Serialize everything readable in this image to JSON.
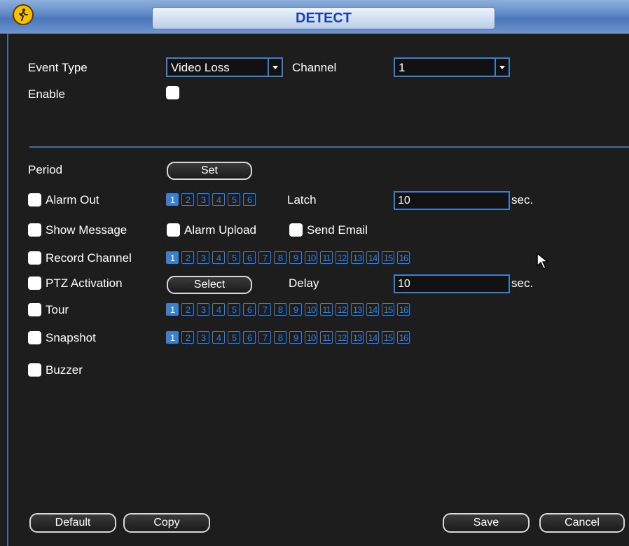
{
  "window": {
    "title": "DETECT",
    "icon": "running-man-icon"
  },
  "event_type": {
    "label": "Event Type",
    "value": "Video Loss"
  },
  "channel": {
    "label": "Channel",
    "value": "1"
  },
  "enable": {
    "label": "Enable",
    "checked": false
  },
  "period": {
    "label": "Period",
    "button": "Set"
  },
  "alarm_out": {
    "label": "Alarm Out",
    "checked": false,
    "outputs": [
      "1",
      "2",
      "3",
      "4",
      "5",
      "6"
    ],
    "selected": [
      "1"
    ]
  },
  "latch": {
    "label": "Latch",
    "value": "10",
    "unit": "sec."
  },
  "show_message": {
    "label": "Show Message",
    "checked": false
  },
  "alarm_upload": {
    "label": "Alarm Upload",
    "checked": false
  },
  "send_email": {
    "label": "Send Email",
    "checked": false
  },
  "record_channel": {
    "label": "Record Channel",
    "checked": false,
    "channels": [
      "1",
      "2",
      "3",
      "4",
      "5",
      "6",
      "7",
      "8",
      "9",
      "10",
      "11",
      "12",
      "13",
      "14",
      "15",
      "16"
    ],
    "selected": [
      "1"
    ]
  },
  "ptz_activation": {
    "label": "PTZ Activation",
    "checked": false,
    "button": "Select"
  },
  "delay": {
    "label": "Delay",
    "value": "10",
    "unit": "sec."
  },
  "tour": {
    "label": "Tour",
    "checked": false,
    "channels": [
      "1",
      "2",
      "3",
      "4",
      "5",
      "6",
      "7",
      "8",
      "9",
      "10",
      "11",
      "12",
      "13",
      "14",
      "15",
      "16"
    ],
    "selected": [
      "1"
    ]
  },
  "snapshot": {
    "label": "Snapshot",
    "checked": false,
    "channels": [
      "1",
      "2",
      "3",
      "4",
      "5",
      "6",
      "7",
      "8",
      "9",
      "10",
      "11",
      "12",
      "13",
      "14",
      "15",
      "16"
    ],
    "selected": [
      "1"
    ]
  },
  "buzzer": {
    "label": "Buzzer",
    "checked": false
  },
  "footer": {
    "default": "Default",
    "copy": "Copy",
    "save": "Save",
    "cancel": "Cancel"
  },
  "colors": {
    "title_bg": "#5b86c4",
    "accent": "#3a7fd0",
    "panel_bg": "#1d1d1d",
    "title_text": "#1a3fb0"
  }
}
